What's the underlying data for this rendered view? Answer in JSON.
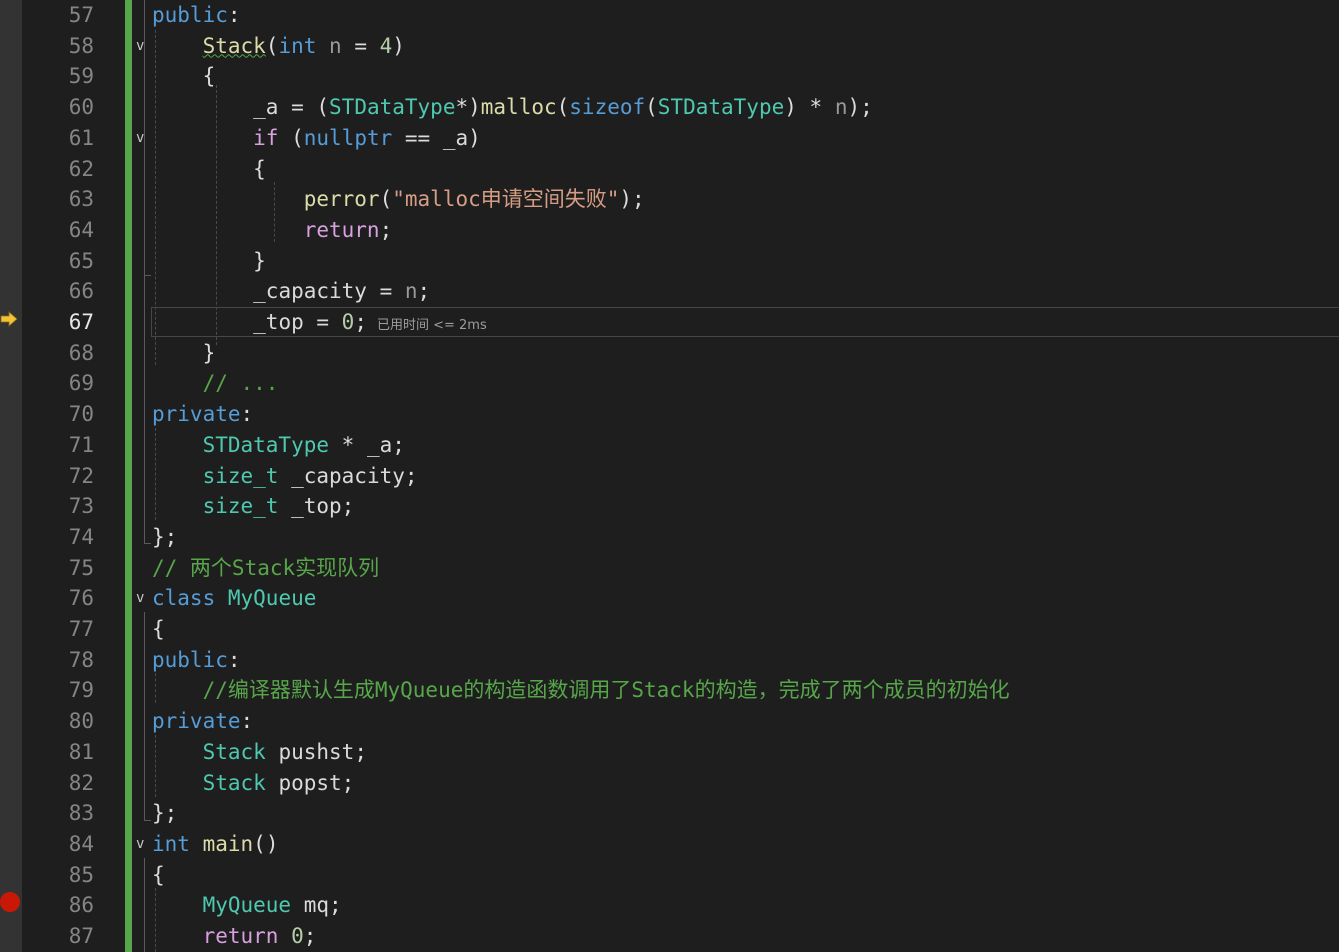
{
  "editor": {
    "theme_colors": {
      "background": "#1e1e1e",
      "change_bar": "#57a64a",
      "breakpoint": "#e51400",
      "exec_arrow": "#f3c13a"
    },
    "current_line": 67,
    "perf_tip": "已用时间 <= 2ms",
    "breakpoint_line": 86,
    "lines": [
      {
        "num": "57",
        "code": "public:"
      },
      {
        "num": "58",
        "code": "    Stack(int n = 4)"
      },
      {
        "num": "59",
        "code": "    {"
      },
      {
        "num": "60",
        "code": "        _a = (STDataType*)malloc(sizeof(STDataType) * n);"
      },
      {
        "num": "61",
        "code": "        if (nullptr == _a)"
      },
      {
        "num": "62",
        "code": "        {"
      },
      {
        "num": "63",
        "code": "            perror(\"malloc申请空间失败\");"
      },
      {
        "num": "64",
        "code": "            return;"
      },
      {
        "num": "65",
        "code": "        }"
      },
      {
        "num": "66",
        "code": "        _capacity = n;"
      },
      {
        "num": "67",
        "code": "        _top = 0;"
      },
      {
        "num": "68",
        "code": "    }"
      },
      {
        "num": "69",
        "code": "    // ..."
      },
      {
        "num": "70",
        "code": "private:"
      },
      {
        "num": "71",
        "code": "    STDataType * _a;"
      },
      {
        "num": "72",
        "code": "    size_t _capacity;"
      },
      {
        "num": "73",
        "code": "    size_t _top;"
      },
      {
        "num": "74",
        "code": "};"
      },
      {
        "num": "75",
        "code": "// 两个Stack实现队列"
      },
      {
        "num": "76",
        "code": "class MyQueue"
      },
      {
        "num": "77",
        "code": "{"
      },
      {
        "num": "78",
        "code": "public:"
      },
      {
        "num": "79",
        "code": "    //编译器默认生成MyQueue的构造函数调用了Stack的构造，完成了两个成员的初始化"
      },
      {
        "num": "80",
        "code": "private:"
      },
      {
        "num": "81",
        "code": "    Stack pushst;"
      },
      {
        "num": "82",
        "code": "    Stack popst;"
      },
      {
        "num": "83",
        "code": "};"
      },
      {
        "num": "84",
        "code": "int main()"
      },
      {
        "num": "85",
        "code": "{"
      },
      {
        "num": "86",
        "code": "    MyQueue mq;"
      },
      {
        "num": "87",
        "code": "    return 0;"
      }
    ]
  }
}
